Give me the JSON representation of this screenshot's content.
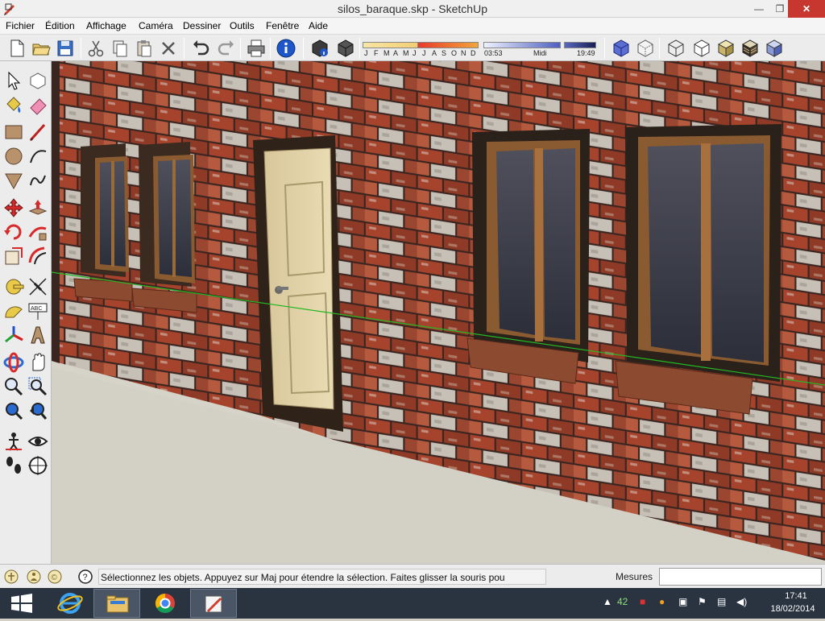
{
  "window": {
    "title": "silos_baraque.skp - SketchUp",
    "controls": {
      "minimize": "—",
      "maximize": "❐",
      "close": "✕"
    }
  },
  "menu": {
    "items": [
      {
        "label": "Fichier"
      },
      {
        "label": "Édition"
      },
      {
        "label": "Affichage"
      },
      {
        "label": "Caméra"
      },
      {
        "label": "Dessiner"
      },
      {
        "label": "Outils"
      },
      {
        "label": "Fenêtre"
      },
      {
        "label": "Aide"
      }
    ]
  },
  "toolbar": {
    "icons": [
      "new-icon",
      "open-icon",
      "save-icon",
      "cut-icon",
      "copy-icon",
      "paste-icon",
      "erase-icon",
      "undo-icon",
      "redo-icon",
      "print-icon",
      "model-info-icon",
      "component-info-icon",
      "component-icon"
    ],
    "view_icons": [
      "iso-view-icon",
      "xray-view-icon",
      "wireframe-icon",
      "hidden-line-icon",
      "shaded-icon",
      "shaded-textures-icon",
      "monochrome-icon"
    ]
  },
  "shadows": {
    "months": [
      "J",
      "F",
      "M",
      "A",
      "M",
      "J",
      "J",
      "A",
      "S",
      "O",
      "N",
      "D"
    ],
    "time_start": "03:53",
    "time_mid": "Midi",
    "time_end": "19:49"
  },
  "left_toolbar": {
    "icons": [
      "select-icon",
      "make-component-icon",
      "paint-bucket-icon",
      "eraser-icon",
      "rectangle-icon",
      "line-icon",
      "circle-icon",
      "arc-icon",
      "polygon-icon",
      "freehand-icon",
      "move-icon",
      "push-pull-icon",
      "rotate-icon",
      "follow-me-icon",
      "scale-icon",
      "offset-icon",
      "tape-measure-icon",
      "dimension-icon",
      "protractor-icon",
      "text-icon",
      "axes-icon",
      "3d-text-icon",
      "orbit-icon",
      "pan-icon",
      "zoom-icon",
      "zoom-window-icon",
      "zoom-extents-icon",
      "previous-view-icon",
      "position-camera-icon",
      "look-around-icon",
      "walk-icon",
      "section-plane-icon"
    ]
  },
  "statusbar": {
    "text": "Sélectionnez les objets. Appuyez sur Maj pour étendre la sélection. Faites glisser la souris pou",
    "measures_label": "Mesures",
    "measures_value": "",
    "icons": [
      "geolocation-icon",
      "credits-icon",
      "user-icon",
      "help-icon"
    ]
  },
  "taskbar": {
    "apps": [
      {
        "name": "start",
        "icon": "windows-start-icon"
      },
      {
        "name": "ie",
        "icon": "internet-explorer-icon"
      },
      {
        "name": "explorer",
        "icon": "file-explorer-icon"
      },
      {
        "name": "chrome",
        "icon": "chrome-icon"
      },
      {
        "name": "sketchup",
        "icon": "sketchup-icon"
      }
    ],
    "tray_count": "42",
    "time": "17:41",
    "date": "18/02/2014"
  }
}
